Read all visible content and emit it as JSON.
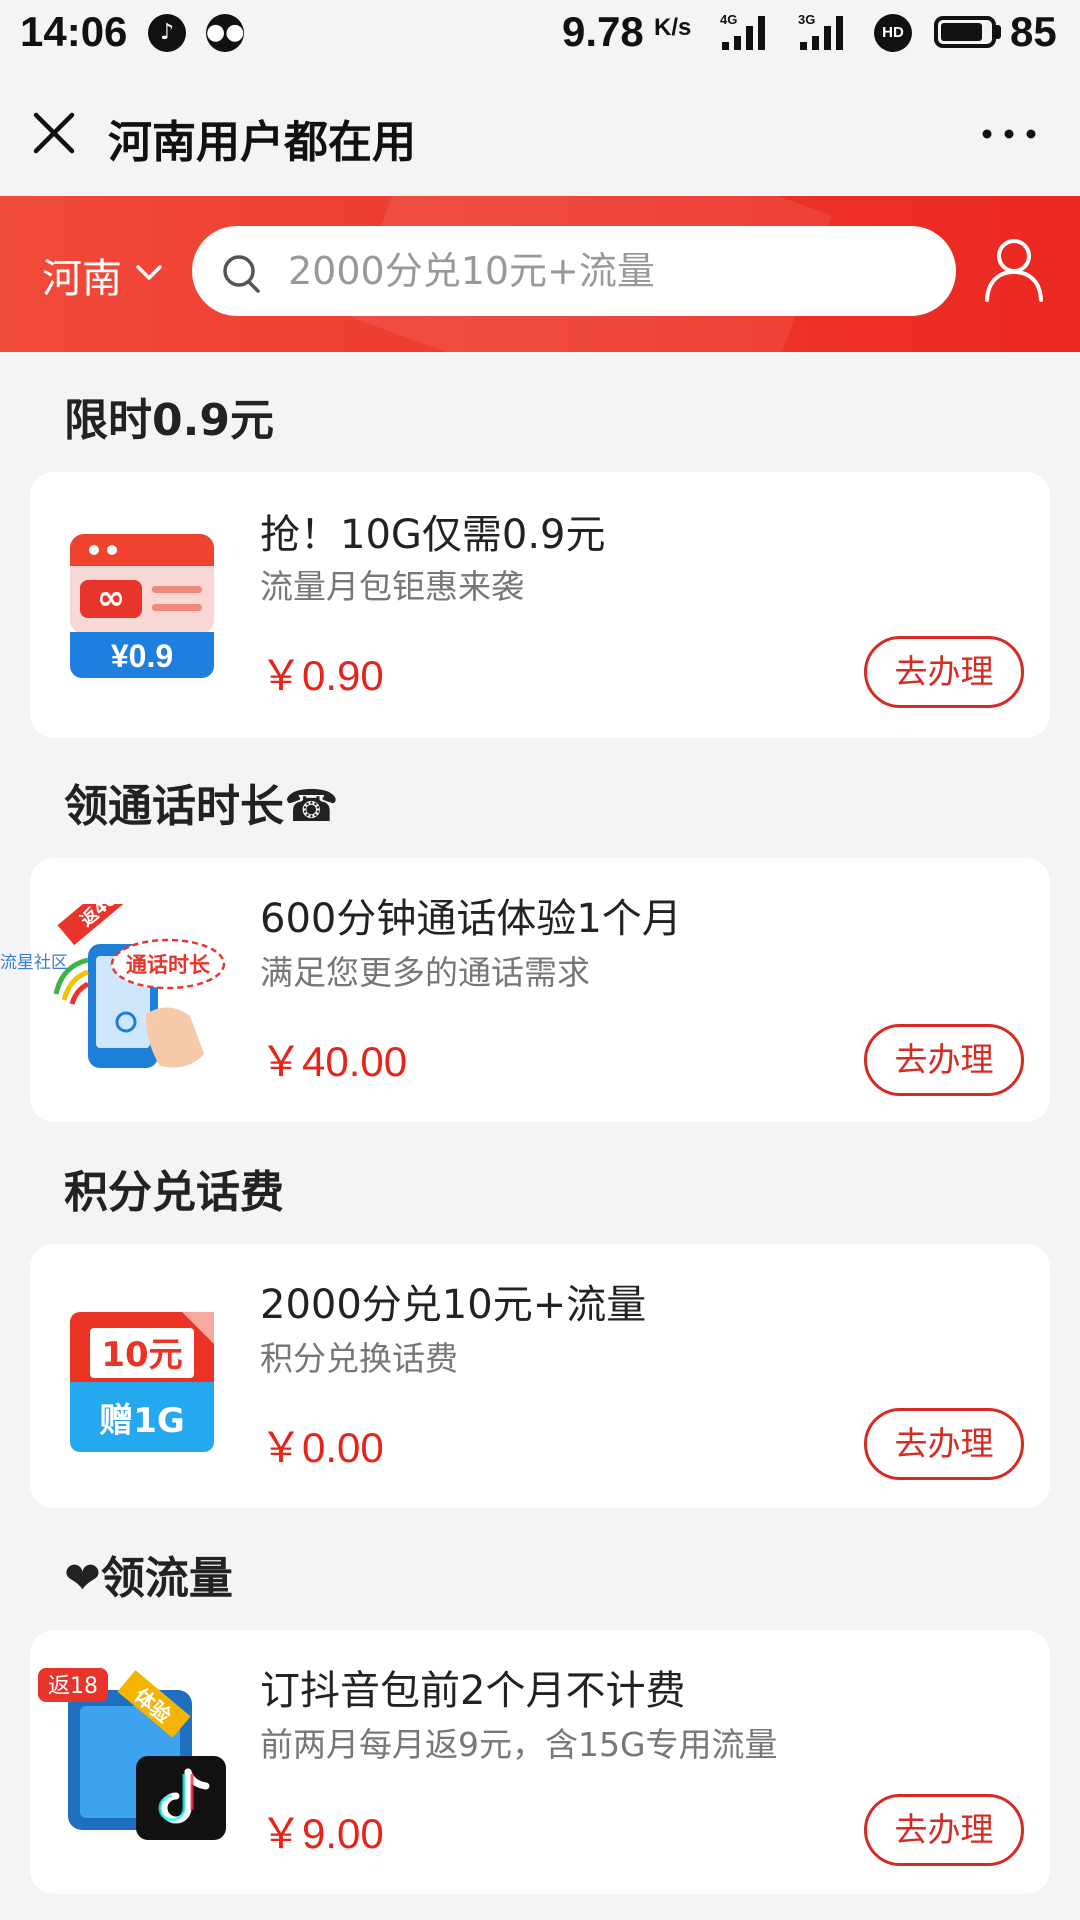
{
  "status_bar": {
    "time": "14:06",
    "speed": "9.78",
    "speed_unit": "K/s",
    "network_1": "4G",
    "network_2": "3G",
    "hd": "HD",
    "battery": "85",
    "battery_level": 0.85
  },
  "title_bar": {
    "title": "河南用户都在用"
  },
  "header": {
    "province": "河南",
    "search_placeholder": "2000分兑10元+流量"
  },
  "sections": [
    {
      "title": "限时0.9元",
      "card": {
        "title": "抢！10G仅需0.9元",
        "subtitle": "流量月包钜惠来袭",
        "price": "￥0.90",
        "button": "去办理",
        "image_text": "¥0.9"
      }
    },
    {
      "title": "领通话时长☎",
      "card": {
        "title": "600分钟通话体验1个月",
        "subtitle": "满足您更多的通话需求",
        "price": "￥40.00",
        "button": "去办理",
        "image_ribbon": "返40元",
        "image_bubble": "通话时长"
      }
    },
    {
      "title": "积分兑话费",
      "card": {
        "title": "2000分兑10元+流量",
        "subtitle": "积分兑换话费",
        "price": "￥0.00",
        "button": "去办理",
        "image_top": "10元",
        "image_bottom": "赠1G"
      }
    },
    {
      "title": "❤领流量",
      "card": {
        "title": "订抖音包前2个月不计费",
        "subtitle": "前两月每月返9元，含15G专用流量",
        "price": "￥9.00",
        "button": "去办理",
        "image_badge": "返18",
        "image_tag": "体验"
      }
    }
  ],
  "watermark": "流星社区",
  "colors": {
    "accent_red": "#e8231a",
    "header_red": "#ee3b30",
    "button_border": "#d62b22"
  }
}
